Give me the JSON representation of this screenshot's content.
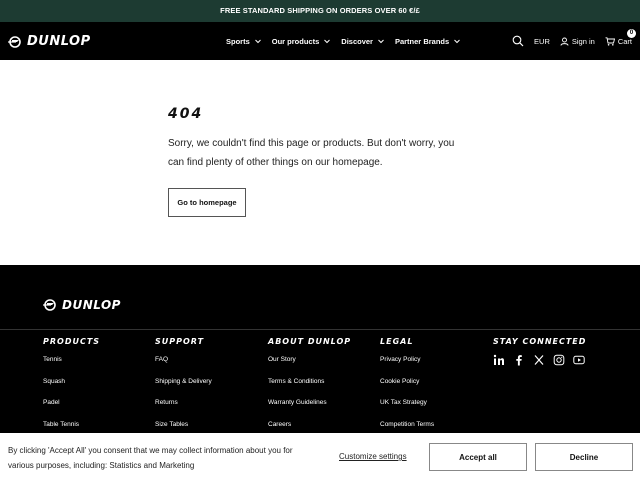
{
  "promo": {
    "text": "FREE STANDARD SHIPPING ON ORDERS OVER 60 €/£"
  },
  "brand": {
    "name": "DUNLOP"
  },
  "nav": {
    "items": [
      {
        "label": "Sports"
      },
      {
        "label": "Our products"
      },
      {
        "label": "Discover"
      },
      {
        "label": "Partner Brands"
      }
    ],
    "currency": "EUR",
    "signin": "Sign in",
    "cart": "Cart",
    "cart_count": "0"
  },
  "error": {
    "code": "404",
    "message": "Sorry, we couldn't find this page or products. But don't worry, you can find plenty of other things on our homepage.",
    "button": "Go to homepage"
  },
  "footer": {
    "products": {
      "title": "PRODUCTS",
      "links": [
        "Tennis",
        "Squash",
        "Padel",
        "Table Tennis"
      ]
    },
    "support": {
      "title": "SUPPORT",
      "links": [
        "FAQ",
        "Shipping & Delivery",
        "Returns",
        "Size Tables"
      ]
    },
    "about": {
      "title": "ABOUT DUNLOP",
      "links": [
        "Our Story",
        "Terms & Conditions",
        "Warranty Guidelines",
        "Careers"
      ]
    },
    "legal": {
      "title": "LEGAL",
      "links": [
        "Privacy Policy",
        "Cookie Policy",
        "UK Tax Strategy",
        "Competition Terms"
      ]
    },
    "social": {
      "title": "STAY CONNECTED",
      "icons": [
        "linkedin-icon",
        "facebook-icon",
        "x-icon",
        "instagram-icon",
        "youtube-icon"
      ]
    }
  },
  "cookie": {
    "text": "By clicking 'Accept All' you consent that we may collect information about you for various purposes, including: Statistics and Marketing",
    "customize": "Customize settings",
    "accept": "Accept all",
    "decline": "Decline"
  },
  "colors": {
    "promo_bg": "#1d3b32",
    "nav_bg": "#000000",
    "footer_bg": "#000000"
  }
}
